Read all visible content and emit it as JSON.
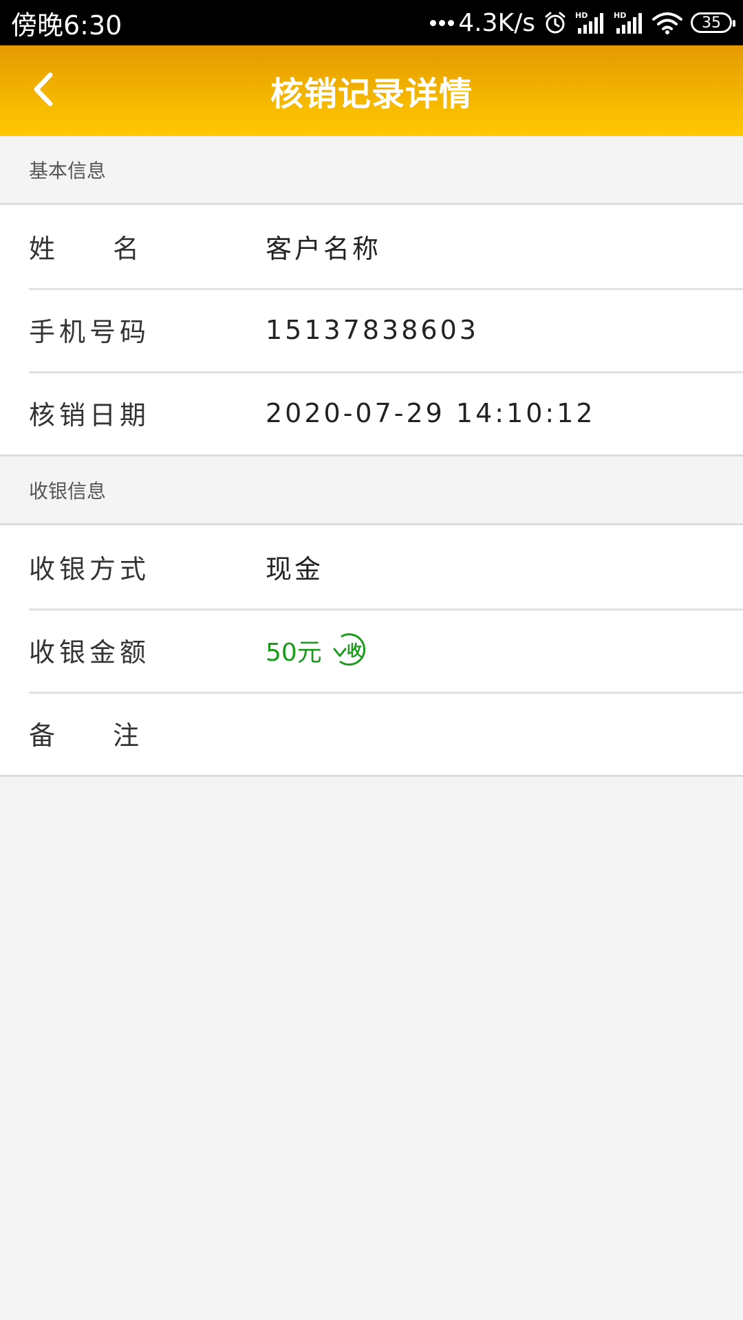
{
  "status_bar": {
    "time": "傍晚6:30",
    "net_speed": "4.3K/s",
    "battery": "35"
  },
  "header": {
    "title": "核销记录详情"
  },
  "basic_section": {
    "title": "基本信息",
    "rows": [
      {
        "label_a": "姓",
        "label_b": "名",
        "value": "客户名称"
      },
      {
        "label": "手机号码",
        "value": "15137838603"
      },
      {
        "label": "核销日期",
        "value": "2020-07-29 14:10:12"
      }
    ]
  },
  "cash_section": {
    "title": "收银信息",
    "rows": [
      {
        "label": "收银方式",
        "value": "现金"
      },
      {
        "label": "收银金额",
        "value": "50元",
        "badge": "收"
      },
      {
        "label_a": "备",
        "label_b": "注",
        "value": ""
      }
    ]
  },
  "colors": {
    "header_top": "#e59a00",
    "header_bottom": "#ffc900",
    "amount_green": "#1b9a1b"
  },
  "icons": [
    "back-arrow-icon",
    "alarm-icon",
    "hd-signal-icon",
    "wifi-icon",
    "battery-icon",
    "receive-badge-icon"
  ]
}
